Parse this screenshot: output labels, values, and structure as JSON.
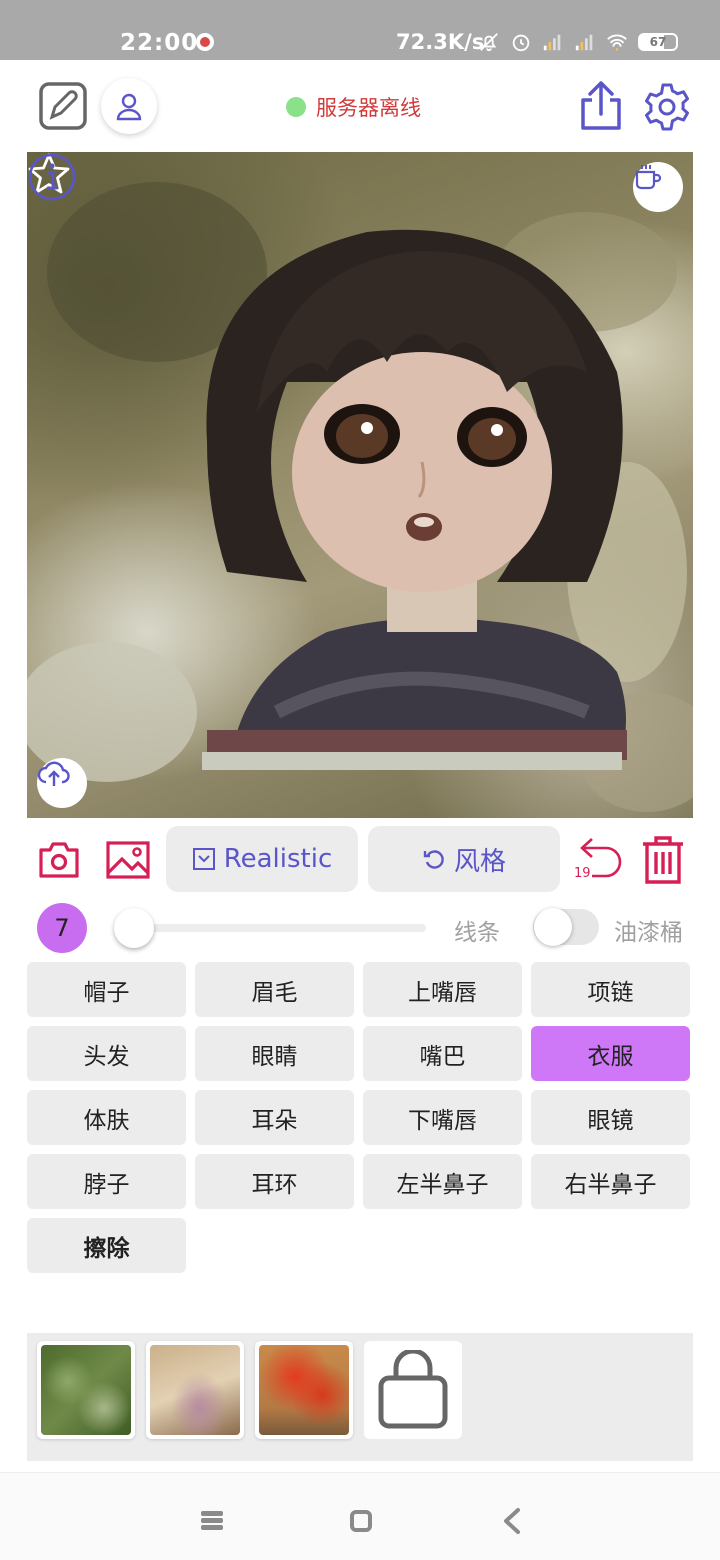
{
  "status_bar": {
    "time": "22:00",
    "network_speed": "72.3K/s",
    "battery": "67"
  },
  "header": {
    "server_status": "服务器离线",
    "server_status_color": "#d23a3a",
    "status_dot_color": "#8be08a"
  },
  "toolbar": {
    "style_label": "Realistic",
    "fengge_label": "风格",
    "undo_count": "19",
    "accent_color": "#d61f55",
    "button_text_color": "#5a56c9"
  },
  "brush": {
    "size": "7",
    "line_label": "线条",
    "bucket_label": "油漆桶",
    "bucket_enabled": false
  },
  "parts": [
    {
      "label": "帽子"
    },
    {
      "label": "眉毛"
    },
    {
      "label": "上嘴唇"
    },
    {
      "label": "项链"
    },
    {
      "label": "头发"
    },
    {
      "label": "眼睛"
    },
    {
      "label": "嘴巴"
    },
    {
      "label": "衣服",
      "active": true
    },
    {
      "label": "体肤"
    },
    {
      "label": "耳朵"
    },
    {
      "label": "下嘴唇"
    },
    {
      "label": "眼镜"
    },
    {
      "label": "脖子"
    },
    {
      "label": "耳环"
    },
    {
      "label": "左半鼻子"
    },
    {
      "label": "右半鼻子"
    },
    {
      "label": "擦除"
    }
  ],
  "active_part_color": "#cf78f7",
  "palette": {
    "swatches": [
      "green-foliage-texture",
      "pink-blossom-texture",
      "red-leaves-texture"
    ],
    "store_icon": "shopping-bag-icon"
  }
}
